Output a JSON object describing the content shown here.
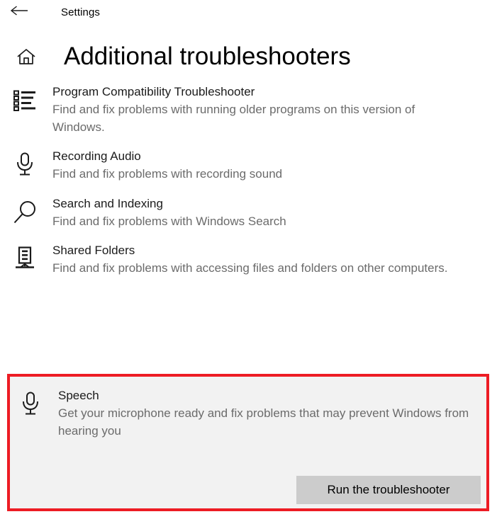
{
  "window": {
    "back_icon": "back-arrow-icon",
    "app_label": "Settings"
  },
  "header": {
    "home_icon": "home-icon",
    "title": "Additional troubleshooters"
  },
  "troubleshooters": [
    {
      "icon": "list-icon",
      "title": "Program Compatibility Troubleshooter",
      "description": "Find and fix problems with running older programs on this version of Windows."
    },
    {
      "icon": "microphone-icon",
      "title": "Recording Audio",
      "description": "Find and fix problems with recording sound"
    },
    {
      "icon": "search-icon",
      "title": "Search and Indexing",
      "description": "Find and fix problems with Windows Search"
    },
    {
      "icon": "server-network-icon",
      "title": "Shared Folders",
      "description": "Find and fix problems with accessing files and folders on other computers."
    }
  ],
  "speech": {
    "icon": "microphone-icon",
    "title": "Speech",
    "description": "Get your microphone ready and fix problems that may prevent Windows from hearing you",
    "run_button_label": "Run the troubleshooter",
    "highlight_color": "#ed1c24",
    "card_background": "#f2f2f2",
    "button_background": "#cccccc"
  },
  "colors": {
    "page_background": "#ffffff",
    "title_text": "#000000",
    "description_text": "#6b6b6b"
  }
}
